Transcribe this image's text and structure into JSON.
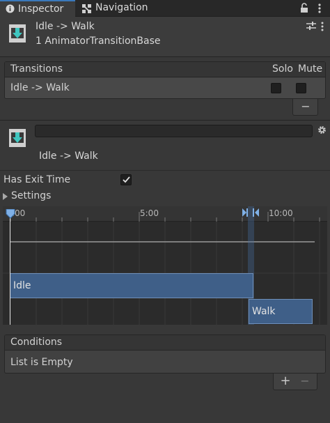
{
  "tabs": {
    "inspector": "Inspector",
    "navigation": "Navigation"
  },
  "header": {
    "title": "Idle -> Walk",
    "subtitle": "1 AnimatorTransitionBase"
  },
  "transitions": {
    "heading": "Transitions",
    "solo": "Solo",
    "mute": "Mute",
    "rows": [
      {
        "label": "Idle -> Walk",
        "solo": false,
        "mute": false
      }
    ],
    "remove": "−"
  },
  "detail": {
    "name_value": "",
    "label": "Idle -> Walk"
  },
  "settings": {
    "has_exit_time_label": "Has Exit Time",
    "has_exit_time": true,
    "settings_label": "Settings"
  },
  "timeline": {
    "ticks": [
      ":00",
      "5:00",
      "10:00"
    ],
    "source_state": "Idle",
    "destination_state": "Walk"
  },
  "conditions": {
    "heading": "Conditions",
    "empty_text": "List is Empty",
    "add": "+",
    "remove": "−"
  },
  "colors": {
    "accent": "#3a79bb",
    "state_bar": "#3f5f88",
    "icon_teal": "#3fc6c0"
  }
}
